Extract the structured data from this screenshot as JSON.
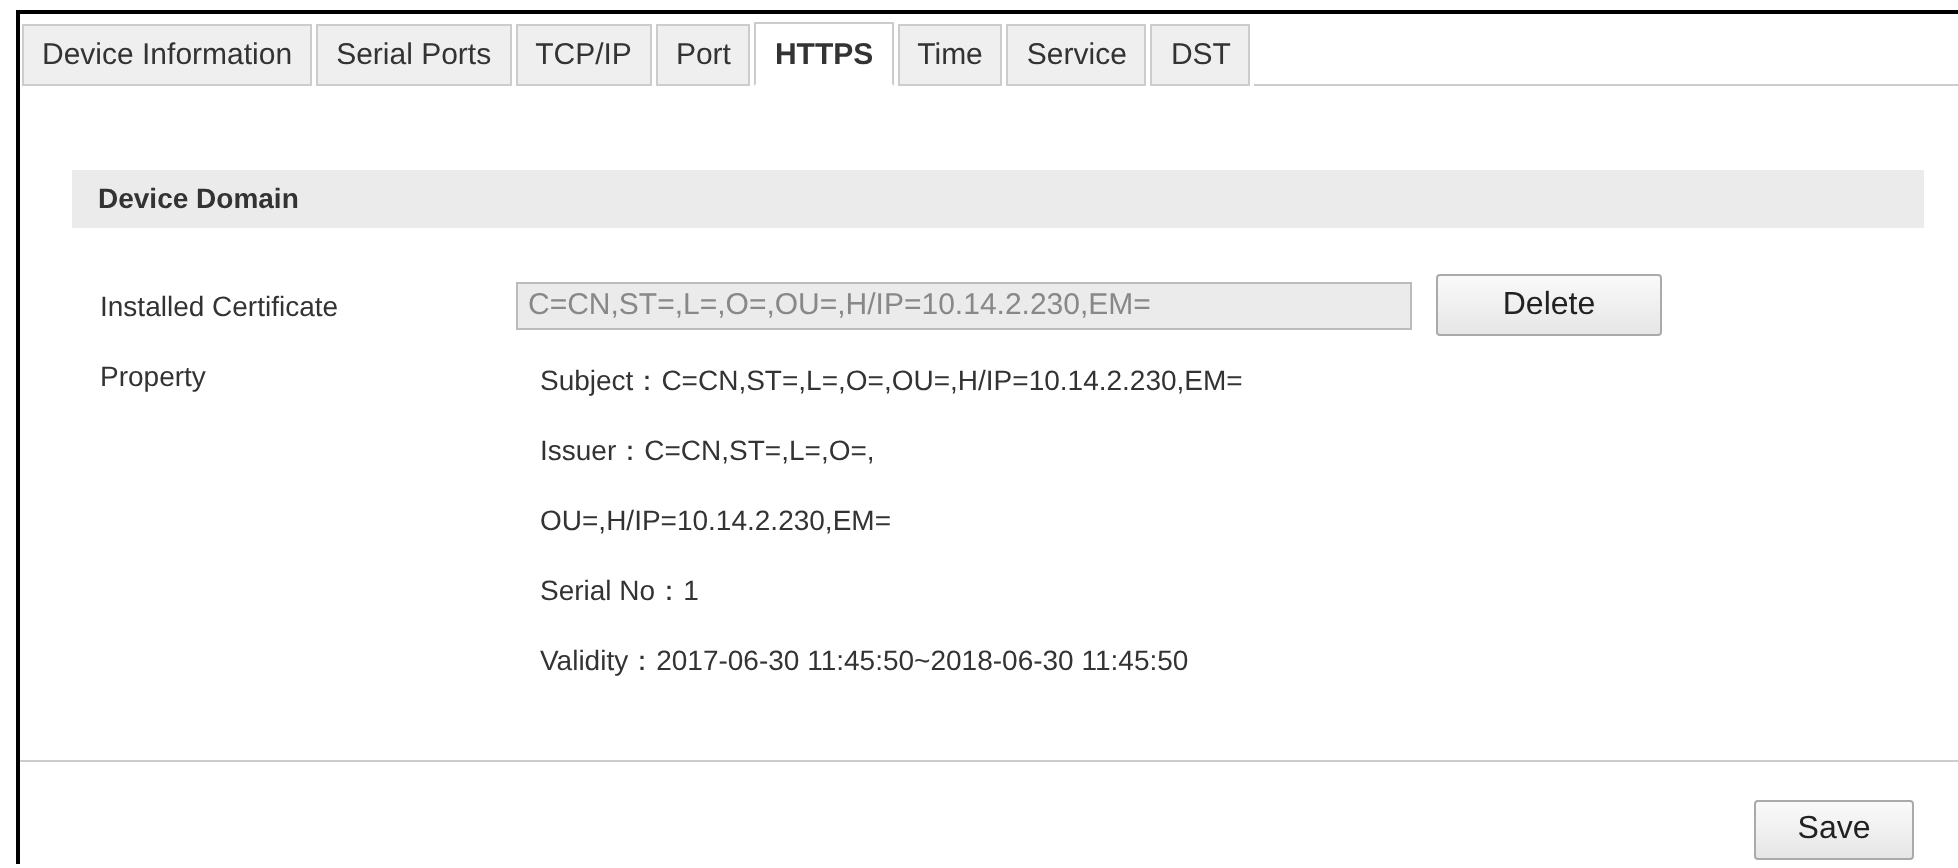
{
  "tabs": [
    {
      "label": "Device Information",
      "selected": false
    },
    {
      "label": "Serial Ports",
      "selected": false
    },
    {
      "label": "TCP/IP",
      "selected": false
    },
    {
      "label": "Port",
      "selected": false
    },
    {
      "label": "HTTPS",
      "selected": true
    },
    {
      "label": "Time",
      "selected": false
    },
    {
      "label": "Service",
      "selected": false
    },
    {
      "label": "DST",
      "selected": false
    }
  ],
  "section": {
    "title": "Device Domain"
  },
  "certificate": {
    "label": "Installed Certificate",
    "value": "C=CN,ST=,L=,O=,OU=,H/IP=10.14.2.230,EM=",
    "disabled": true,
    "button": "Delete"
  },
  "property": {
    "label": "Property",
    "lines": [
      "Subject：C=CN,ST=,L=,O=,OU=,H/IP=10.14.2.230,EM=",
      "Issuer：C=CN,ST=,L=,O=,",
      "OU=,H/IP=10.14.2.230,EM=",
      "Serial No：1",
      "Validity：2017-06-30 11:45:50~2018-06-30 11:45:50"
    ]
  },
  "save_button": "Save"
}
